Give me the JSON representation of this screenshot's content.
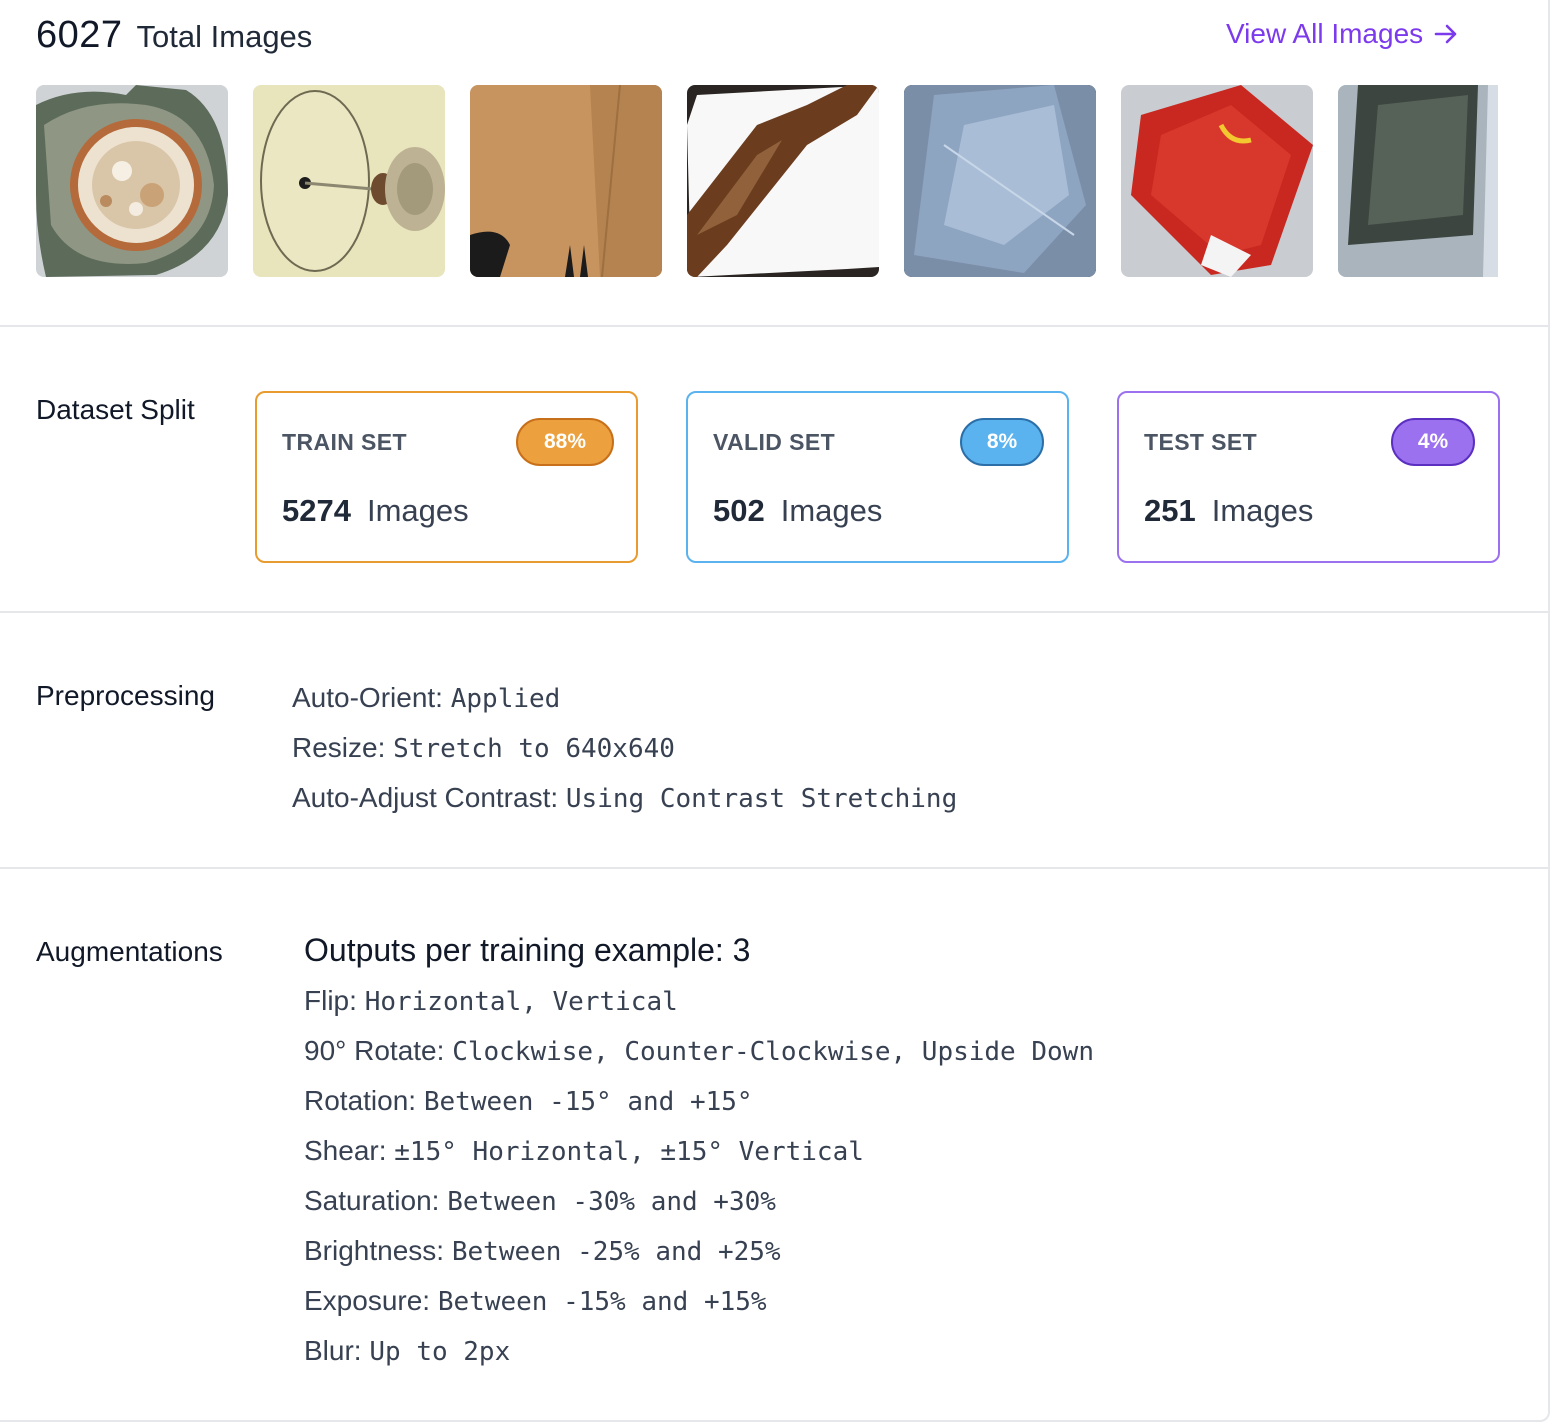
{
  "header": {
    "total_count": "6027",
    "total_label": "Total Images",
    "view_all_label": "View All Images"
  },
  "thumbnails": [
    {
      "name": "rusty-can-thumbnail"
    },
    {
      "name": "glass-dish-thumbnail"
    },
    {
      "name": "cardboard-box-thumbnail"
    },
    {
      "name": "brown-bottle-thumbnail"
    },
    {
      "name": "plastic-sheet-thumbnail"
    },
    {
      "name": "food-wrapper-thumbnail"
    },
    {
      "name": "dark-glass-thumbnail"
    }
  ],
  "dataset_split": {
    "label": "Dataset Split",
    "sets": [
      {
        "name": "TRAIN SET",
        "percent": "88%",
        "count": "5274",
        "unit": "Images",
        "color": "#e89b2e"
      },
      {
        "name": "VALID SET",
        "percent": "8%",
        "count": "502",
        "unit": "Images",
        "color": "#5ab3ef"
      },
      {
        "name": "TEST SET",
        "percent": "4%",
        "count": "251",
        "unit": "Images",
        "color": "#9b71f0"
      }
    ]
  },
  "preprocessing": {
    "label": "Preprocessing",
    "items": [
      {
        "key": "Auto-Orient:",
        "value": "Applied"
      },
      {
        "key": "Resize:",
        "value": "Stretch to 640x640"
      },
      {
        "key": "Auto-Adjust Contrast:",
        "value": "Using Contrast Stretching"
      }
    ]
  },
  "augmentations": {
    "label": "Augmentations",
    "outputs": "Outputs per training example: 3",
    "items": [
      {
        "key": "Flip:",
        "value": "Horizontal, Vertical"
      },
      {
        "key": "90° Rotate:",
        "value": "Clockwise, Counter-Clockwise, Upside Down"
      },
      {
        "key": "Rotation:",
        "value": "Between -15° and +15°"
      },
      {
        "key": "Shear:",
        "value": "±15° Horizontal, ±15° Vertical"
      },
      {
        "key": "Saturation:",
        "value": "Between -30% and +30%"
      },
      {
        "key": "Brightness:",
        "value": "Between -25% and +25%"
      },
      {
        "key": "Exposure:",
        "value": "Between -15% and +15%"
      },
      {
        "key": "Blur:",
        "value": "Up to 2px"
      }
    ]
  },
  "colors": {
    "accent": "#7c3aed",
    "divider": "#e5e7eb"
  }
}
